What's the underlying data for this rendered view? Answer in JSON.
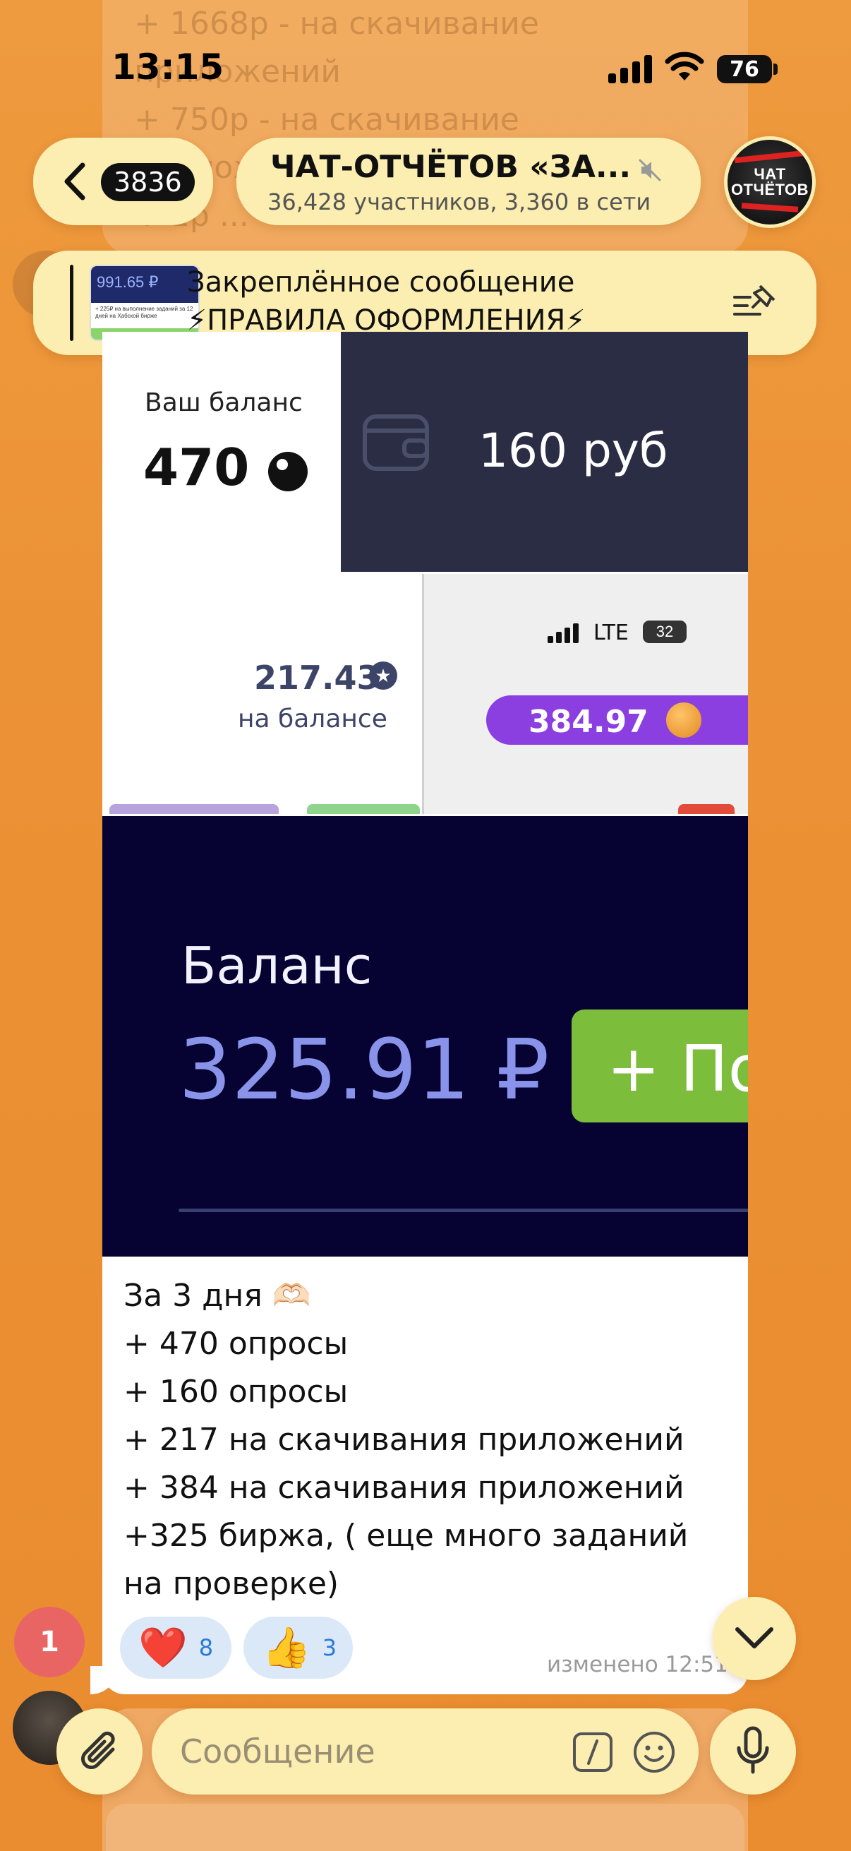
{
  "status_bar": {
    "time": "13:15",
    "battery": "76"
  },
  "background_message": {
    "lines": [
      "+ 1668р - на скачивание",
      "приложений",
      "+ 750р - на скачивание",
      "приложений",
      "+ 1р ..."
    ]
  },
  "header": {
    "back_count": "3836",
    "chat_title": "ЧАТ-ОТЧЁТОВ «ЗА...",
    "chat_subtitle": "36,428 участников, 3,360 в сети",
    "avatar_text": "ЧАТ ОТЧЁТОВ",
    "muted": true
  },
  "pinned": {
    "title": "Закреплённое сообщение",
    "text": "⚡ПРАВИЛА ОФОРМЛЕНИЯ⚡",
    "thumb_value": "991.65 ₽",
    "thumb_text": "+ 225₽ на выполнение заданий за 12 дней на Хабской бирже"
  },
  "message": {
    "photos": {
      "p1_label": "Ваш баланс",
      "p1_value": "470",
      "p2_value": "160 руб",
      "p3_value": "217.43",
      "p3_label": "на балансе",
      "p4_network": "LTE",
      "p4_battery": "32",
      "p4_value": "384.97",
      "p5_label": "Баланс",
      "p5_value": "325.91 ₽",
      "p5_button": "+ По"
    },
    "text_lines": [
      "За 3 дня 🫶🏻",
      "+ 470 опросы",
      "+ 160 опросы",
      "+ 217 на скачивания приложений",
      "+ 384 на скачивания приложений",
      "+325 биржа, ( еще много заданий",
      "на проверке)"
    ],
    "reactions": [
      {
        "emoji": "❤️",
        "count": "8"
      },
      {
        "emoji": "👍",
        "count": "3"
      }
    ],
    "edited_time": "изменено 12:51"
  },
  "unread_mentions": "1",
  "composer": {
    "placeholder": "Сообщение"
  },
  "colors": {
    "background": "#ec9135",
    "pill": "#fbeeb0",
    "reaction_bg": "#dbe8f7",
    "reaction_count": "#2a7ad4",
    "unread_badge": "#e86564"
  }
}
